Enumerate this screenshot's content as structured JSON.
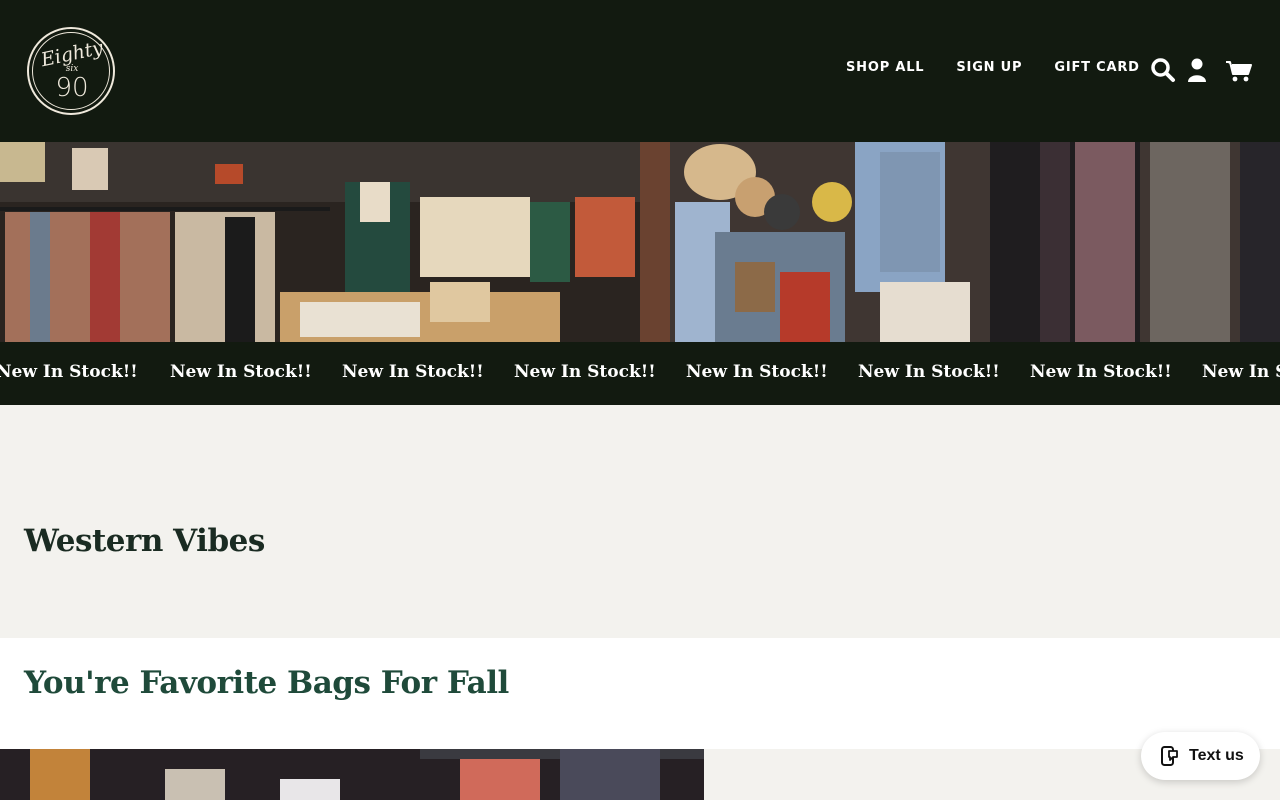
{
  "header": {
    "logo": {
      "line1": "Eighty",
      "line2": "six",
      "line3": "90"
    },
    "nav": [
      {
        "label": "SHOP ALL"
      },
      {
        "label": "SIGN UP"
      },
      {
        "label": "GIFT CARD"
      }
    ],
    "icons": {
      "search": "search-icon",
      "account": "account-icon",
      "cart": "cart-icon"
    }
  },
  "hero": {
    "alt": "store interior"
  },
  "ticker": {
    "items": [
      "New In Stock!!",
      "New In Stock!!",
      "New In Stock!!",
      "New In Stock!!",
      "New In Stock!!",
      "New In Stock!!",
      "New In Stock!!",
      "New In Stock!!"
    ]
  },
  "sections": {
    "western_title": "Western Vibes",
    "bags_title": "You're Favorite Bags For Fall"
  },
  "chat": {
    "label": "Text us"
  },
  "colors": {
    "header_bg": "#121a10",
    "page_bg": "#f3f2ee",
    "heading": "#1f4a3a"
  }
}
